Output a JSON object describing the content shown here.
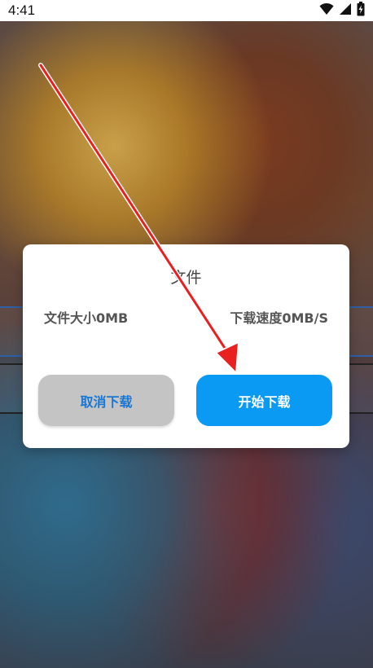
{
  "status_bar": {
    "time": "4:41",
    "icons": [
      "wifi-icon",
      "signal-icon",
      "battery-icon"
    ]
  },
  "dialog": {
    "title": "文件",
    "file_size": "文件大小0MB",
    "download_speed": "下载速度0MB/S",
    "cancel_label": "取消下载",
    "start_label": "开始下载"
  },
  "colors": {
    "start_button": "#0a9af4",
    "cancel_button": "#c4c4c4",
    "cancel_text": "#1976d2",
    "annotation_arrow": "#e82020"
  }
}
